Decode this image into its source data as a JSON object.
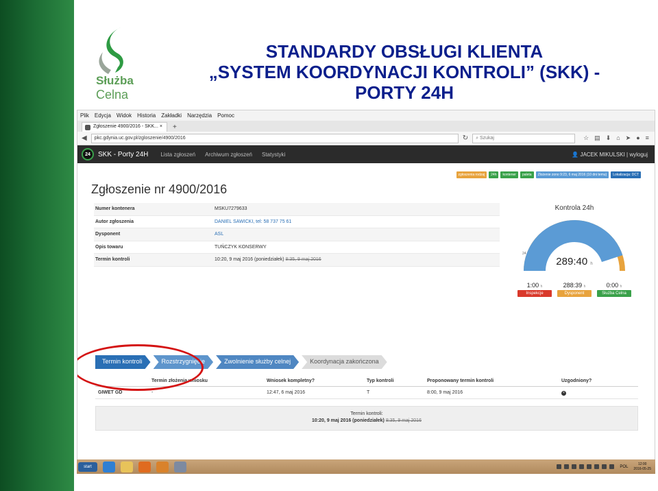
{
  "slide": {
    "logo_line1": "Służba",
    "logo_line2": "Celna",
    "title_line1": "STANDARDY OBSŁUGI KLIENTA",
    "title_line2": "„SYSTEM KOORDYNACJI KONTROLI” (SKK) -",
    "title_line3": "PORTY 24H"
  },
  "browser": {
    "menu": [
      "Plik",
      "Edycja",
      "Widok",
      "Historia",
      "Zakładki",
      "Narzędzia",
      "Pomoc"
    ],
    "tab_title": "Zgłoszenie 4900/2016 - SKK...",
    "new_tab": "+",
    "url": "pkc.gdynia.uc.gov.pl/zgloszenie/4900/2016",
    "search_placeholder": "Szukaj"
  },
  "app": {
    "badge": "24",
    "brand": "SKK - Porty 24H",
    "nav": [
      "Lista zgłoszeń",
      "Archiwum zgłoszeń",
      "Statystyki"
    ],
    "user": "JACEK MIKULSKI | wyloguj"
  },
  "tags": [
    {
      "label": "zgłoszenia rodzaj",
      "color": "#e8a33d"
    },
    {
      "label": "24h",
      "color": "#3aa14a"
    },
    {
      "label": "kontener",
      "color": "#3aa14a"
    },
    {
      "label": "paleta",
      "color": "#3aa14a"
    },
    {
      "label": "Złożenie zono 9:23, 6 maj 2016 (10 dni temu)",
      "color": "#5b9bd5"
    },
    {
      "label": "Lokalizacja: DCT",
      "color": "#2a6fb5"
    }
  ],
  "page_title": "Zgłoszenie nr 4900/2016",
  "details": [
    {
      "label": "Numer kontenera",
      "value": "MSKU7279633",
      "link": false,
      "strike": ""
    },
    {
      "label": "Autor zgłoszenia",
      "value": "DANIEL SAWICKI, tel: 58 737 75 61",
      "link": true,
      "strike": ""
    },
    {
      "label": "Dysponent",
      "value": "ASL",
      "link": true,
      "strike": ""
    },
    {
      "label": "Opis towaru",
      "value": "TUŃCZYK KONSERWY",
      "link": false,
      "strike": ""
    },
    {
      "label": "Termin kontroli",
      "value": "10:20, 9 maj 2016 (poniedziałek)",
      "link": false,
      "strike": "8:35, 9 maj 2016"
    }
  ],
  "kontrola": {
    "title": "Kontrola 24h",
    "time": "289:40",
    "time_unit": "h",
    "left_small": "24",
    "progress": 0.9,
    "stats": [
      {
        "value": "1:00",
        "unit": "h",
        "label": "Inspekcje",
        "color": "#d9392b"
      },
      {
        "value": "288:39",
        "unit": "h",
        "label": "Dysponent",
        "color": "#e8a33d"
      },
      {
        "value": "0:00",
        "unit": "h",
        "label": "Służba Celna",
        "color": "#3aa14a"
      }
    ]
  },
  "steps": [
    "Termin kontroli",
    "Rozstrzygnięcie",
    "Zwolnienie służby celnej",
    "Koordynacja zakończona"
  ],
  "table": {
    "headers": [
      "",
      "Termin złożenia wniosku",
      "Wniosek kompletny?",
      "Typ kontroli",
      "Proponowany termin kontroli",
      "Uzgodniony?"
    ],
    "rows": [
      [
        "GIWET GD",
        "-",
        "12:47, 6 maj 2016",
        "T",
        "8:00, 9 maj 2016",
        "×"
      ]
    ]
  },
  "summary": {
    "label": "Termin kontroli:",
    "value": "10:20, 9 maj 2016 (poniedziałek)",
    "old": "8:35, 9 maj 2016"
  },
  "taskbar": {
    "start": "start",
    "lang": "POL",
    "time": "12:00",
    "date": "2016-05-25"
  }
}
